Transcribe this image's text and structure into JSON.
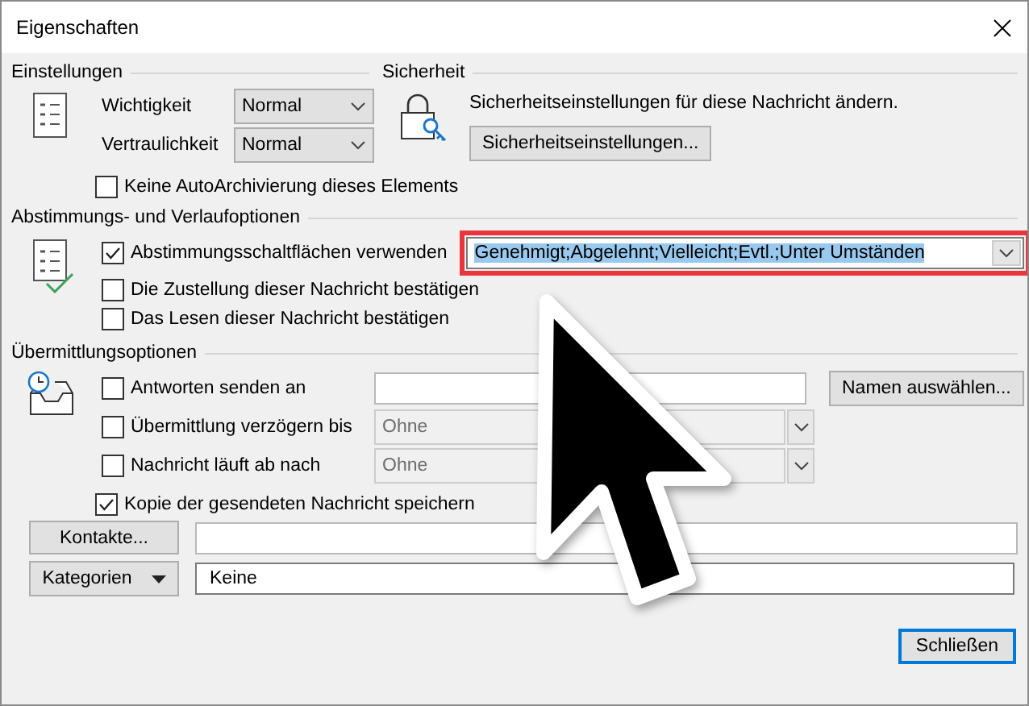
{
  "window": {
    "title": "Eigenschaften"
  },
  "settings": {
    "heading": "Einstellungen",
    "fields": [
      {
        "label": "Wichtigkeit",
        "value": "Normal"
      },
      {
        "label": "Vertraulichkeit",
        "value": "Normal"
      }
    ],
    "no_autoarchive": {
      "label": "Keine AutoArchivierung dieses Elements",
      "checked": false
    }
  },
  "security": {
    "heading": "Sicherheit",
    "description": "Sicherheitseinstellungen für diese Nachricht ändern.",
    "button": "Sicherheitseinstellungen..."
  },
  "voting": {
    "heading": "Abstimmungs- und Verlaufoptionen",
    "options": [
      {
        "label": "Abstimmungsschaltflächen verwenden",
        "checked": true
      },
      {
        "label": "Die Zustellung dieser Nachricht bestätigen",
        "checked": false
      },
      {
        "label": "Das Lesen dieser Nachricht bestätigen",
        "checked": false
      }
    ],
    "choices": {
      "value": "Genehmigt;Abgelehnt;Vielleicht;Evtl.;Unter Umständen",
      "text_selected": true,
      "highlighted": true
    }
  },
  "delivery": {
    "heading": "Übermittlungsoptionen",
    "reply_to": {
      "label": "Antworten senden an",
      "checked": false,
      "button": "Namen auswählen..."
    },
    "delay": {
      "label": "Übermittlung verzögern bis",
      "checked": false,
      "value": "Ohne",
      "disabled": true
    },
    "expires": {
      "label": "Nachricht läuft ab nach",
      "checked": false,
      "value": "Ohne",
      "disabled": true
    },
    "save_copy": {
      "label": "Kopie der gesendeten Nachricht speichern",
      "checked": true
    }
  },
  "contacts": {
    "button": "Kontakte..."
  },
  "categories": {
    "button": "Kategorien",
    "value": "Keine"
  },
  "close_button": "Schließen",
  "cursor_overlay": true
}
